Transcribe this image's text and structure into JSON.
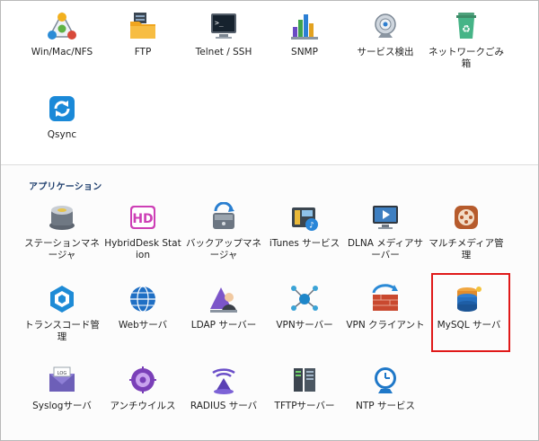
{
  "system_items": [
    {
      "label": "Win/Mac/NFS",
      "icon": "network-share-icon"
    },
    {
      "label": "FTP",
      "icon": "ftp-folder-icon"
    },
    {
      "label": "Telnet / SSH",
      "icon": "terminal-icon"
    },
    {
      "label": "SNMP",
      "icon": "snmp-chart-icon"
    },
    {
      "label": "サービス検出",
      "icon": "service-discovery-icon"
    },
    {
      "label": "ネットワークごみ箱",
      "icon": "recycle-bin-icon"
    },
    {
      "label": "Qsync",
      "icon": "qsync-icon"
    }
  ],
  "applications": {
    "title": "アプリケーション",
    "items": [
      {
        "label": "ステーションマネージャ",
        "icon": "station-manager-icon"
      },
      {
        "label": "HybridDesk Station",
        "icon": "hybriddesk-icon"
      },
      {
        "label": "バックアップマネージャ",
        "icon": "backup-manager-icon"
      },
      {
        "label": "iTunes サービス",
        "icon": "itunes-service-icon"
      },
      {
        "label": "DLNA メディアサーバー",
        "icon": "dlna-media-server-icon"
      },
      {
        "label": "マルチメディア管理",
        "icon": "multimedia-icon"
      },
      {
        "label": "トランスコード管理",
        "icon": "transcode-icon"
      },
      {
        "label": "Webサーバ",
        "icon": "web-globe-icon"
      },
      {
        "label": "LDAP サーバー",
        "icon": "ldap-server-icon"
      },
      {
        "label": "VPNサーバー",
        "icon": "vpn-server-icon"
      },
      {
        "label": "VPN クライアント",
        "icon": "vpn-client-icon"
      },
      {
        "label": "MySQL サーバ",
        "icon": "mysql-database-icon"
      },
      {
        "label": "Syslogサーバ",
        "icon": "syslog-envelope-icon"
      },
      {
        "label": "アンチウイルス",
        "icon": "antivirus-icon"
      },
      {
        "label": "RADIUS サーバ",
        "icon": "radius-server-icon"
      },
      {
        "label": "TFTPサーバー",
        "icon": "tftp-server-icon"
      },
      {
        "label": "NTP サービス",
        "icon": "ntp-clock-icon"
      }
    ]
  },
  "highlighted_item": "MySQL サーバ",
  "colors": {
    "section_title": "#1f3f6e",
    "highlight": "#e01919"
  }
}
